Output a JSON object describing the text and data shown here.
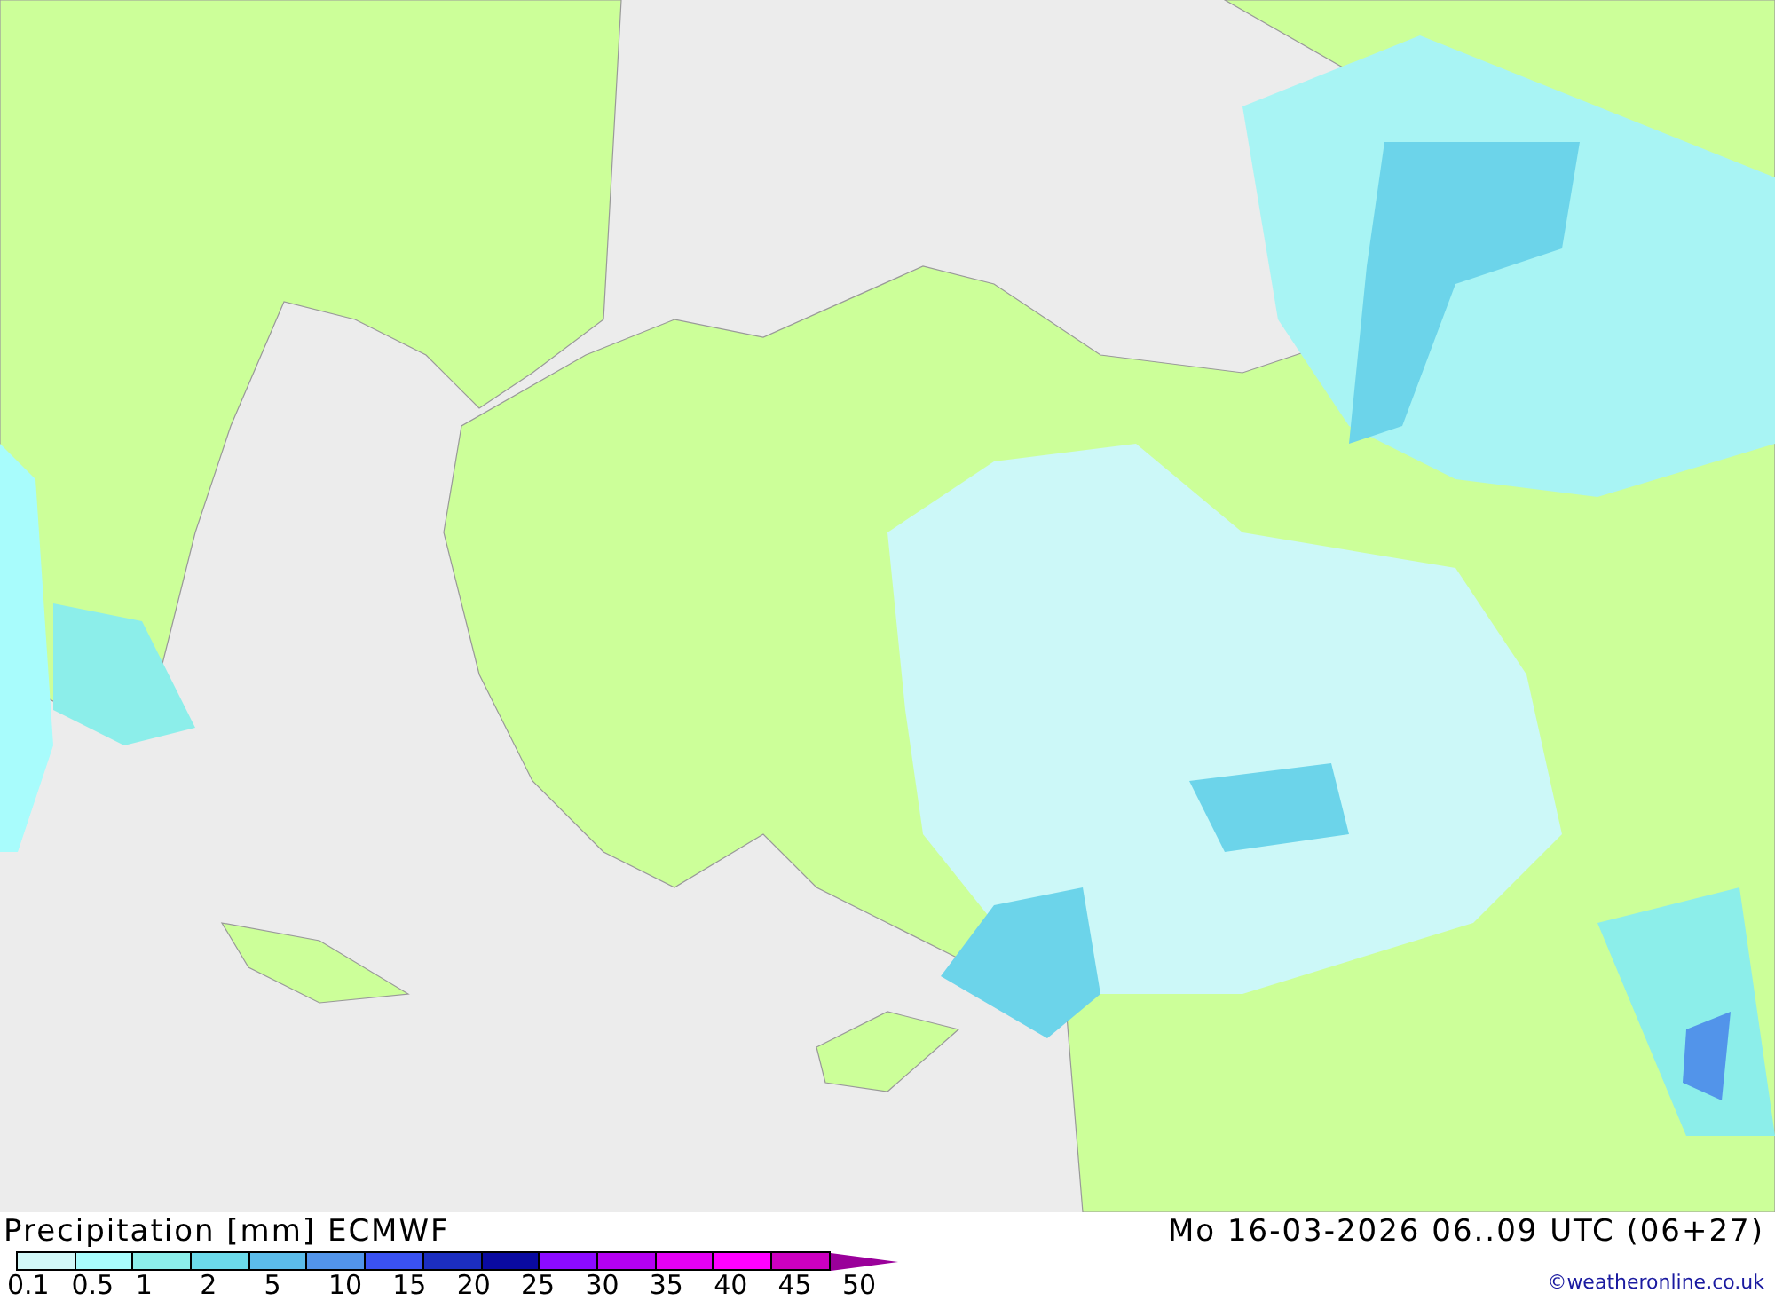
{
  "legend": {
    "title": "Precipitation [mm] ECMWF",
    "bins": [
      {
        "color": "#d2f8f8"
      },
      {
        "color": "#a8fcfc"
      },
      {
        "color": "#8ceeea"
      },
      {
        "color": "#6cdaea"
      },
      {
        "color": "#5cbcea"
      },
      {
        "color": "#5294ea"
      },
      {
        "color": "#3a52f2"
      },
      {
        "color": "#1c2ec0"
      },
      {
        "color": "#0a0aa0"
      },
      {
        "color": "#8c0aff"
      },
      {
        "color": "#b400f2"
      },
      {
        "color": "#e400f4"
      },
      {
        "color": "#ff00ff"
      },
      {
        "color": "#cc00c0"
      }
    ],
    "overflow": {
      "color": "#9a009a"
    },
    "ticks": [
      "0.1",
      "0.5",
      "1",
      "2",
      "5",
      "10",
      "15",
      "20",
      "25",
      "30",
      "35",
      "40",
      "45",
      "50"
    ]
  },
  "valid_time": "Mo 16-03-2026 06..09 UTC (06+27)",
  "credit": "©weatheronline.co.uk"
}
